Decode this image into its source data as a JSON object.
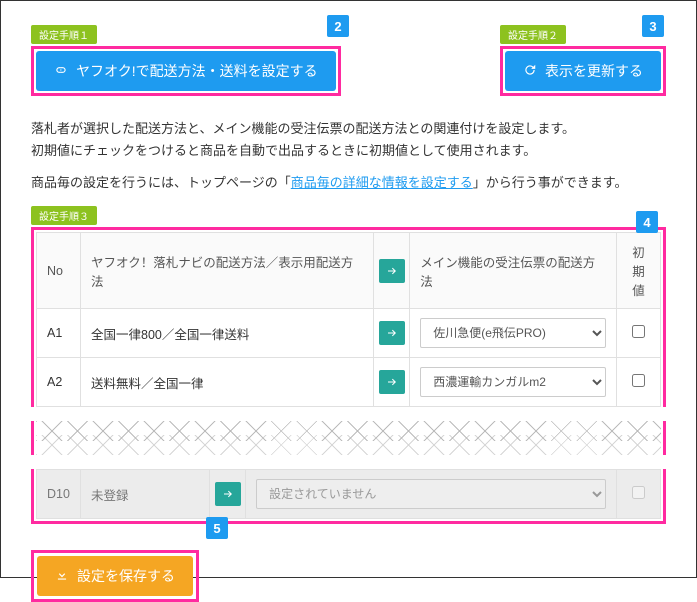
{
  "steps": {
    "s1": "設定手順１",
    "s2": "設定手順２",
    "s3": "設定手順３"
  },
  "buttons": {
    "configure": "ヤフオク!で配送方法・送料を設定する",
    "refresh": "表示を更新する",
    "save": "設定を保存する"
  },
  "badges": {
    "b2": "2",
    "b3": "3",
    "b4": "4",
    "b5": "5"
  },
  "desc": {
    "line1": "落札者が選択した配送方法と、メイン機能の受注伝票の配送方法との関連付けを設定します。",
    "line2": "初期値にチェックをつけると商品を自動で出品するときに初期値として使用されます。",
    "line3a": "商品毎の設定を行うには、トップページの「",
    "line3link": "商品毎の詳細な情報を設定する",
    "line3b": "」から行う事ができます。"
  },
  "table": {
    "headers": {
      "no": "No",
      "method": "ヤフオク！落札ナビの配送方法／表示用配送方法",
      "arrow": "",
      "main": "メイン機能の受注伝票の配送方法",
      "default": "初期値"
    },
    "rows": [
      {
        "no": "A1",
        "method": "全国一律800／全国一律送料",
        "select": "佐川急便(e飛伝PRO)",
        "checkable": true
      },
      {
        "no": "A2",
        "method": "送料無料／全国一律",
        "select": "西濃運輸カンガルm2",
        "checkable": true
      }
    ],
    "bottom_row": {
      "no": "D10",
      "method": "未登録",
      "select": "設定されていません",
      "checkable": false
    }
  }
}
